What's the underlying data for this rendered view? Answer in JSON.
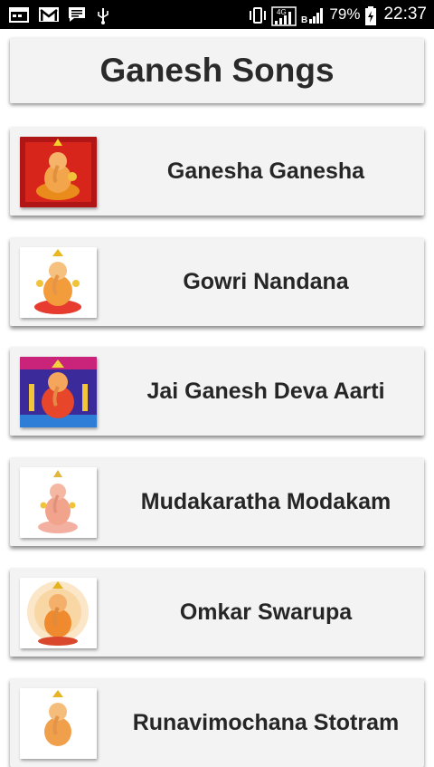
{
  "status_bar": {
    "battery_percent": "79%",
    "time": "22:37",
    "icons": [
      "calendar-icon",
      "gmail-icon",
      "message-icon",
      "usb-icon",
      "vibrate-icon",
      "signal-4g-icon",
      "signal-icon",
      "battery-icon"
    ],
    "network_label": "4G"
  },
  "header": {
    "title": "Ganesh Songs"
  },
  "songs": [
    {
      "title": "Ganesha Ganesha",
      "thumb_bg": "#b01616"
    },
    {
      "title": "Gowri Nandana",
      "thumb_bg": "#ffffff"
    },
    {
      "title": "Jai Ganesh Deva Aarti",
      "thumb_bg": "#3a2a9a"
    },
    {
      "title": "Mudakaratha Modakam",
      "thumb_bg": "#ffffff"
    },
    {
      "title": "Omkar Swarupa",
      "thumb_bg": "#fbe6c8"
    },
    {
      "title": "Runavimochana Stotram",
      "thumb_bg": "#ffffff"
    }
  ]
}
